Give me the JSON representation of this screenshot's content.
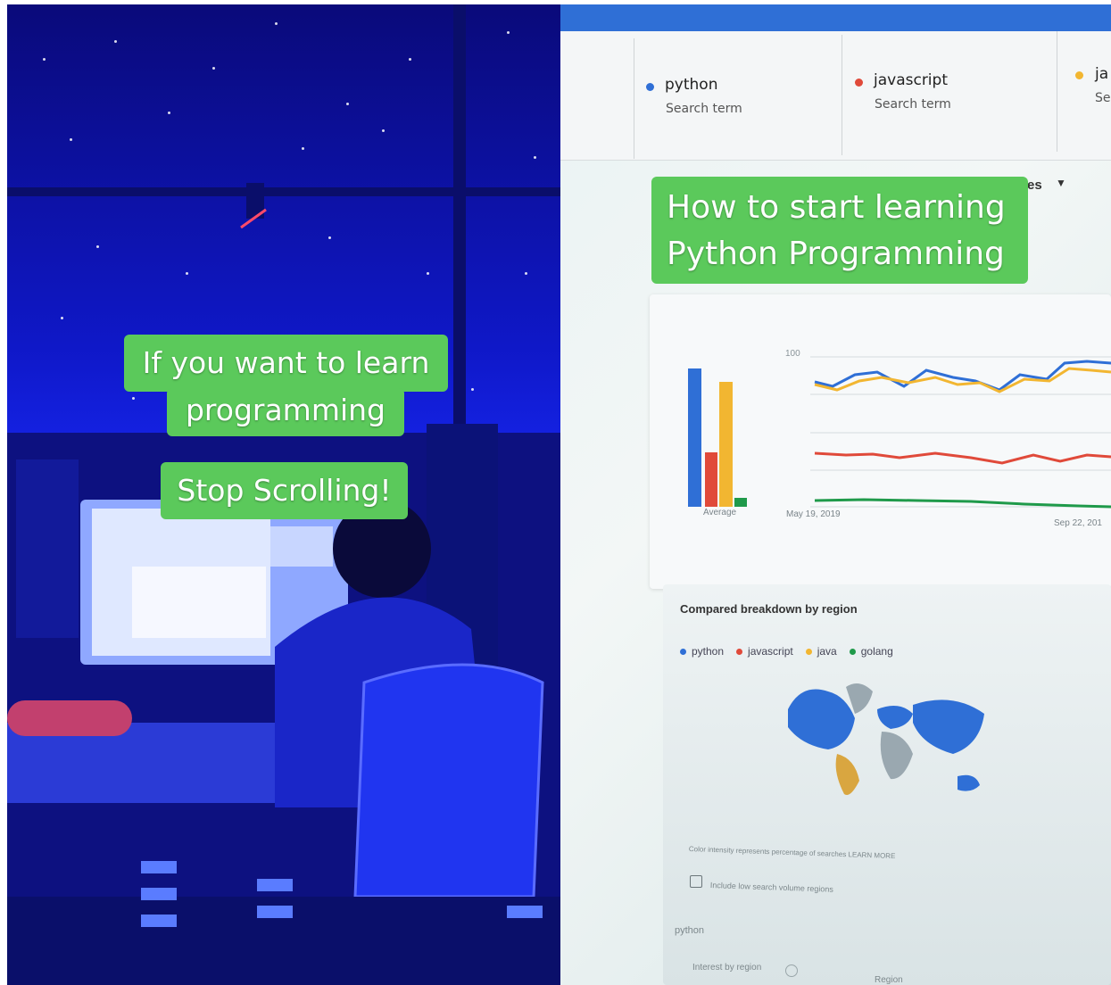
{
  "left": {
    "caption_line1": "If you want to learn",
    "caption_line2": "programming",
    "caption_stop": "Stop Scrolling!"
  },
  "right": {
    "caption_line1": "How to start learning",
    "caption_line2": "Python Programming",
    "terms": [
      {
        "label": "python",
        "sub": "Search term",
        "color": "#2f6fd6"
      },
      {
        "label": "javascript",
        "sub": "Search term",
        "color": "#e04a3a"
      },
      {
        "label": "ja",
        "sub": "Se",
        "color": "#f2b631"
      }
    ],
    "dropdown_fragment": "es",
    "chart": {
      "average_label": "Average",
      "date_start": "May 19, 2019",
      "date_end": "Sep 22, 201",
      "tick_100": "100"
    },
    "region": {
      "title": "Compared breakdown by region",
      "legend": [
        {
          "label": "python",
          "color": "#2f6fd6"
        },
        {
          "label": "javascript",
          "color": "#e04a3a"
        },
        {
          "label": "java",
          "color": "#f2b631"
        },
        {
          "label": "golang",
          "color": "#1f9a4a"
        }
      ],
      "note": "Color intensity represents percentage of searches LEARN MORE",
      "checkbox_label": "Include low search volume regions",
      "footer_term": "python",
      "interest_label": "Interest by region",
      "region_header": "Region"
    }
  }
}
